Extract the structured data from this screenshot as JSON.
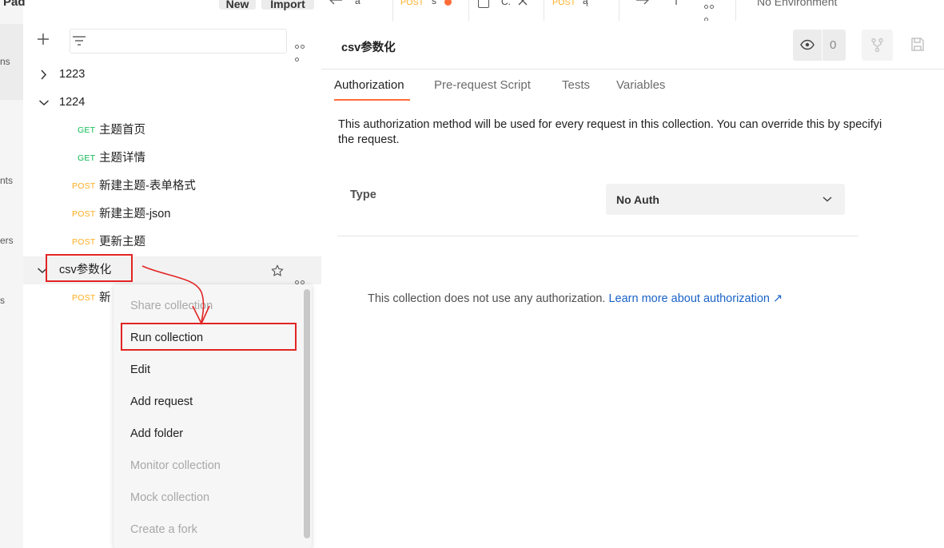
{
  "rail": {
    "items": [
      "ns",
      "nts",
      "ers",
      "s"
    ]
  },
  "header": {
    "workspace_label": "Pad",
    "new_label": "New",
    "import_label": "Import"
  },
  "tabs": [
    {
      "method": "",
      "label": "ā"
    },
    {
      "method": "POST",
      "label": "ś"
    },
    {
      "method": "",
      "label": "C."
    },
    {
      "method": "POST",
      "label": "ą"
    }
  ],
  "environment": "No Environment",
  "sidebar": {
    "tree": [
      {
        "kind": "folder",
        "label": "1223",
        "expanded": false
      },
      {
        "kind": "folder",
        "label": "1224",
        "expanded": true
      },
      {
        "kind": "request",
        "method": "GET",
        "label": "主题首页"
      },
      {
        "kind": "request",
        "method": "GET",
        "label": "主题详情"
      },
      {
        "kind": "request",
        "method": "POST",
        "label": "新建主题-表单格式"
      },
      {
        "kind": "request",
        "method": "POST",
        "label": "新建主题-json"
      },
      {
        "kind": "request",
        "method": "POST",
        "label": "更新主题"
      },
      {
        "kind": "collection",
        "label": "csv参数化",
        "expanded": true
      },
      {
        "kind": "request",
        "method": "POST",
        "label": "新"
      }
    ]
  },
  "context_menu": {
    "items": [
      {
        "label": "Share collection",
        "enabled": false
      },
      {
        "label": "Run collection",
        "enabled": true
      },
      {
        "label": "Edit",
        "enabled": true
      },
      {
        "label": "Add request",
        "enabled": true
      },
      {
        "label": "Add folder",
        "enabled": true
      },
      {
        "label": "Monitor collection",
        "enabled": false
      },
      {
        "label": "Mock collection",
        "enabled": false
      },
      {
        "label": "Create a fork",
        "enabled": false
      }
    ]
  },
  "main": {
    "title": "csv参数化",
    "watch_count": "0",
    "subtabs": [
      "Authorization",
      "Pre-request Script",
      "Tests",
      "Variables"
    ],
    "active_subtab": "Authorization",
    "description_line1": "This authorization method will be used for every request in this collection. You can override this by specifyi",
    "description_line2": "the request.",
    "type_label": "Type",
    "type_value": "No Auth",
    "info_text": "This collection does not use any authorization.",
    "info_link": "Learn more about authorization ↗"
  },
  "colors": {
    "accent": "#ff6c37",
    "get": "#0cbb52",
    "post": "#ffad1f",
    "annotation": "#e22424",
    "link": "#1a63c7"
  }
}
